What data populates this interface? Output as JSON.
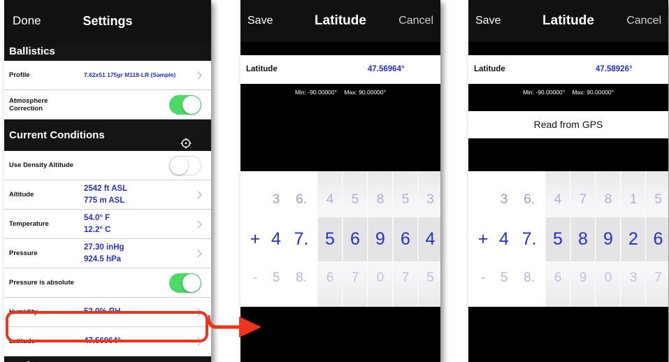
{
  "settings": {
    "nav": {
      "done": "Done",
      "title": "Settings"
    },
    "sections": {
      "ballistics": "Ballistics",
      "current_conditions": "Current Conditions",
      "preferences": "Preferences"
    },
    "rows": {
      "profile": {
        "label": "Profile",
        "value": "7.62x51 175gr M118-LR (Sample)"
      },
      "atmosphere": {
        "label": "Atmosphere Correction",
        "toggle": "on"
      },
      "density_altitude": {
        "label": "Use Density Altitude",
        "toggle": "off"
      },
      "altitude": {
        "label": "Altitude",
        "value1": "2542 ft ASL",
        "value2": "775 m ASL"
      },
      "temperature": {
        "label": "Temperature",
        "value1": "54.0° F",
        "value2": "12.2° C"
      },
      "pressure": {
        "label": "Pressure",
        "value1": "27.30 inHg",
        "value2": "924.5 hPa"
      },
      "pressure_absolute": {
        "label": "Pressure is absolute",
        "toggle": "on"
      },
      "humidity": {
        "label": "Humidity",
        "value": "52.0% RH"
      },
      "latitude": {
        "label": "Latitude",
        "value": "47.56964°"
      }
    },
    "icons": {
      "chevron": "chevron-right-icon",
      "location": "crosshair-icon"
    }
  },
  "editor1": {
    "nav": {
      "save": "Save",
      "title": "Latitude",
      "cancel": "Cancel"
    },
    "label": "Latitude",
    "value": "47.56964°",
    "min": "Min: -90.00000°",
    "max": "Max: 90.00000°",
    "picker": {
      "top": [
        "",
        "3",
        "6.",
        "4",
        "5",
        "8",
        "5",
        "3"
      ],
      "mid": [
        "+",
        "4",
        "7.",
        "5",
        "6",
        "9",
        "6",
        "4"
      ],
      "bot": [
        "-",
        "5",
        "8.",
        "6",
        "7",
        "0",
        "7",
        "5"
      ]
    }
  },
  "editor2": {
    "nav": {
      "save": "Save",
      "title": "Latitude",
      "cancel": "Cancel"
    },
    "label": "Latitude",
    "value": "47.58926°",
    "min": "Min: -90.00000°",
    "max": "Max: 90.00000°",
    "gps_button": "Read from GPS",
    "picker": {
      "top": [
        "",
        "3",
        "6.",
        "4",
        "7",
        "8",
        "1",
        "5"
      ],
      "mid": [
        "+",
        "4",
        "7.",
        "5",
        "8",
        "9",
        "2",
        "6"
      ],
      "bot": [
        "-",
        "5",
        "8.",
        "6",
        "9",
        "0",
        "3",
        "7"
      ]
    }
  },
  "colors": {
    "accent_blue": "#2330d6",
    "toggle_on": "#4cd964",
    "highlight_red": "#f0341b",
    "nav_background": "#111111"
  }
}
